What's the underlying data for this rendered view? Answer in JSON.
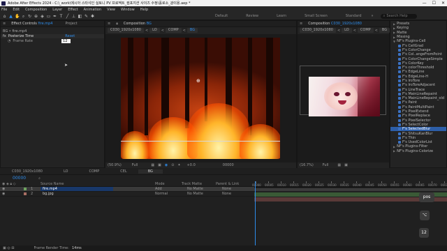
{
  "window": {
    "title": "Adobe After Effects 2024 - C:\\_work\\에시아 스타샤인 실토니 PV 프로젝트_컴포지션 사이즈 수정\\홀로소_광이용.aep *",
    "controls": [
      "—",
      "☐",
      "✕"
    ]
  },
  "menu": [
    "File",
    "Edit",
    "Composition",
    "Layer",
    "Effect",
    "Animation",
    "View",
    "Window",
    "Help"
  ],
  "toolbar": {
    "workspaces": [
      "Default",
      "Review",
      "Learn",
      "Small Screen",
      "Standard"
    ],
    "search_placeholder": "Search Help"
  },
  "effect_controls": {
    "tab_label": "Effect Controls",
    "tab_file": "fire.mp4",
    "project_tab": "Project",
    "layer_path": "BG • fire.mp4",
    "effect_name": "Posterize Time",
    "reset_label": "Reset",
    "param_label": "Frame Rate",
    "param_value": "12"
  },
  "comp_main": {
    "tab_label": "Composition",
    "tab_comp": "BG",
    "breadcrumbs": [
      "C030_1920x1080",
      "LO",
      "COMP",
      "BG"
    ],
    "zoom": "(50.9%)",
    "quality": "Full",
    "timecode": "00000",
    "exposure": "+0.0"
  },
  "comp_secondary": {
    "tab_label": "Composition",
    "tab_comp": "C030_1920x1080",
    "breadcrumbs": [
      "C030_1920x1080",
      "LO",
      "COMP",
      "BG"
    ],
    "zoom": "(16.7%)",
    "quality": "Full"
  },
  "effects_panel": {
    "items": [
      {
        "label": "Presets",
        "type": "category"
      },
      {
        "label": "Keying",
        "type": "category"
      },
      {
        "label": "Matte",
        "type": "category"
      },
      {
        "label": "Missing",
        "type": "category"
      },
      {
        "label": "NF's Plugins-Cell",
        "type": "category"
      },
      {
        "label": "F's CellGrad",
        "type": "fx"
      },
      {
        "label": "F's ColorChange",
        "type": "fx"
      },
      {
        "label": "F's Col..angeFromPoint",
        "type": "fx"
      },
      {
        "label": "F's ColorChangeSimple",
        "type": "fx"
      },
      {
        "label": "F's ColorKey",
        "type": "fx"
      },
      {
        "label": "F's colorThreshold",
        "type": "fx"
      },
      {
        "label": "F's EdgeLine",
        "type": "fx"
      },
      {
        "label": "F's EdgeLine-H",
        "type": "fx"
      },
      {
        "label": "F's IroTore",
        "type": "fx"
      },
      {
        "label": "F's IroToreAdjacent",
        "type": "fx"
      },
      {
        "label": "F's LineTrace",
        "type": "fx"
      },
      {
        "label": "F's MainLineRepaint",
        "type": "fx"
      },
      {
        "label": "F's MainLineRepaint_old",
        "type": "fx"
      },
      {
        "label": "F's Paint",
        "type": "fx"
      },
      {
        "label": "F's PaintMultiPaint",
        "type": "fx"
      },
      {
        "label": "F's PixelExtend",
        "type": "fx"
      },
      {
        "label": "F's PixelReplace",
        "type": "fx"
      },
      {
        "label": "F's PixelSelector",
        "type": "fx"
      },
      {
        "label": "F's SelectColor",
        "type": "fx"
      },
      {
        "label": "F's SelectedBlur",
        "type": "fx",
        "selected": true
      },
      {
        "label": "F's ShitsuKanBlur",
        "type": "fx"
      },
      {
        "label": "F's Thin",
        "type": "fx"
      },
      {
        "label": "F's UsedColorList",
        "type": "fx"
      },
      {
        "label": "NF's Plugins-Filter",
        "type": "category"
      },
      {
        "label": "NF's Plugins-Colorize",
        "type": "category"
      }
    ]
  },
  "timeline": {
    "comp_tabs": [
      "C030_1920x1080",
      "LO",
      "COMP",
      "CEL",
      "BG"
    ],
    "timecode": "00000",
    "columns": {
      "source_name": "Source Name",
      "mode": "Mode",
      "track_matte": "Track Matte",
      "parent": "Parent & Link"
    },
    "layers": [
      {
        "num": "1",
        "name": "fire.mp4",
        "mode": "Add",
        "matte": "No Matte",
        "parent": "None",
        "selected": true
      },
      {
        "num": "2",
        "name": "bg.jpg",
        "mode": "Normal",
        "matte": "No Matte",
        "parent": "None",
        "selected": false
      }
    ],
    "ruler": [
      "00000",
      "00005",
      "00010",
      "00015",
      "00020",
      "00025",
      "00030",
      "00035",
      "00040",
      "00045",
      "00050",
      "00055",
      "00060",
      "00065",
      "00070",
      "00075"
    ],
    "frame_render_label": "Frame Render Time:",
    "frame_render_value": "14ms"
  },
  "overlay_keys": {
    "key_top": "pos",
    "key_mid": "⌥",
    "key_bottom": "12"
  },
  "colors": {
    "accent": "#2d8ceb",
    "selected": "#2d5ea8",
    "layer_bar": "#3f6e3a",
    "playhead": "#2d8ceb"
  }
}
